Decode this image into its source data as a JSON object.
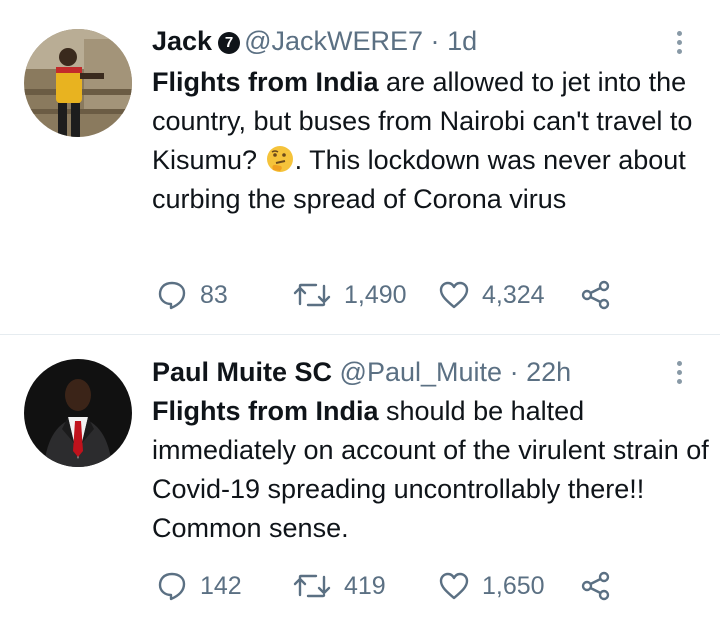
{
  "tweets": [
    {
      "name": "Jack",
      "badge": "7",
      "handle": "@JackWERE7",
      "separator": "·",
      "time": "1d",
      "text_bold": "Flights from India",
      "text_part1": " are allowed to jet into the country, but buses from Nairobi can't travel to Kisumu? ",
      "text_part2": ". This lockdown was never about curbing the spread of Corona virus",
      "replies": "83",
      "retweets": "1,490",
      "likes": "4,324",
      "colors": {
        "avatar_bg": "#8a7a5e",
        "jersey": "#e8b320"
      }
    },
    {
      "name": "Paul Muite SC",
      "handle": "@Paul_Muite",
      "separator": "·",
      "time": "22h",
      "text_bold": "Flights from India",
      "text_part1": " should be halted immediately on account of the virulent strain of Covid-19 spreading uncontrollably there!! Common sense.",
      "replies": "142",
      "retweets": "419",
      "likes": "1,650",
      "colors": {
        "avatar_bg": "#111111",
        "tie": "#c0121c"
      }
    }
  ],
  "icons": {
    "reply": "speech-bubble-icon",
    "retweet": "retweet-icon",
    "like": "heart-icon",
    "share": "share-icon",
    "more": "more-vertical-icon",
    "emoji": "thinking-face-emoji"
  },
  "colors": {
    "text": "#0f1419",
    "secondary": "#5b7083",
    "divider": "#e6ecf0"
  }
}
